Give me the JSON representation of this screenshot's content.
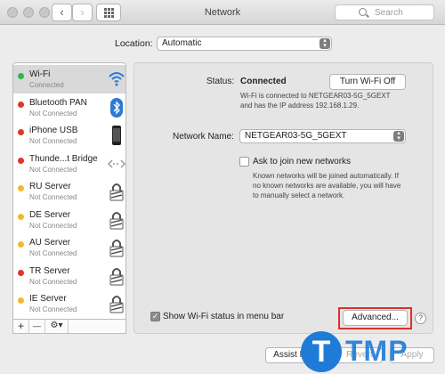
{
  "window": {
    "title": "Network",
    "search_placeholder": "Search",
    "back_glyph": "‹",
    "forward_glyph": "›"
  },
  "location": {
    "label": "Location:",
    "value": "Automatic"
  },
  "services": [
    {
      "name": "Wi-Fi",
      "status": "Connected",
      "dot": "#2fb84a",
      "icon": "wifi-icon"
    },
    {
      "name": "Bluetooth PAN",
      "status": "Not Connected",
      "dot": "#e0352b",
      "icon": "bluetooth-icon"
    },
    {
      "name": "iPhone USB",
      "status": "Not Connected",
      "dot": "#e0352b",
      "icon": "iphone-icon"
    },
    {
      "name": "Thunde...t Bridge",
      "status": "Not Connected",
      "dot": "#e0352b",
      "icon": "thunderbolt-bridge-icon"
    },
    {
      "name": "RU Server",
      "status": "Not Connected",
      "dot": "#f2b833",
      "icon": "vpn-lock-icon"
    },
    {
      "name": "DE Server",
      "status": "Not Connected",
      "dot": "#f2b833",
      "icon": "vpn-lock-icon"
    },
    {
      "name": "AU Server",
      "status": "Not Connected",
      "dot": "#f2b833",
      "icon": "vpn-lock-icon"
    },
    {
      "name": "TR Server",
      "status": "Not Connected",
      "dot": "#e0352b",
      "icon": "vpn-lock-icon"
    },
    {
      "name": "IE Server",
      "status": "Not Connected",
      "dot": "#f2b833",
      "icon": "vpn-lock-icon"
    }
  ],
  "sidebar_buttons": {
    "add": "+",
    "remove": "—",
    "gear": "⚙▾"
  },
  "status": {
    "label": "Status:",
    "value": "Connected",
    "turn_off_button": "Turn Wi-Fi Off",
    "description_line1": "Wi-Fi is connected to NETGEAR03-5G_5GEXT",
    "description_line2": "and has the IP address 192.168.1.29."
  },
  "network_name": {
    "label": "Network Name:",
    "value": "NETGEAR03-5G_5GEXT"
  },
  "ask_to_join": {
    "label": "Ask to join new networks",
    "checked": false,
    "help_line1": "Known networks will be joined automatically. If",
    "help_line2": "no known networks are available, you will have",
    "help_line3": "to manually select a network."
  },
  "show_status": {
    "label": "Show Wi-Fi status in menu bar",
    "checked": true,
    "check_glyph": "✓"
  },
  "buttons": {
    "advanced": "Advanced...",
    "help": "?",
    "assist": "Assist Me...",
    "revert": "Revert",
    "apply": "Apply"
  },
  "watermark": {
    "letter": "T",
    "text": "TMP"
  },
  "colors": {
    "highlight": "#d8322b",
    "connected": "#2fb84a",
    "disconnected": "#e0352b",
    "inactive": "#f2b833"
  }
}
